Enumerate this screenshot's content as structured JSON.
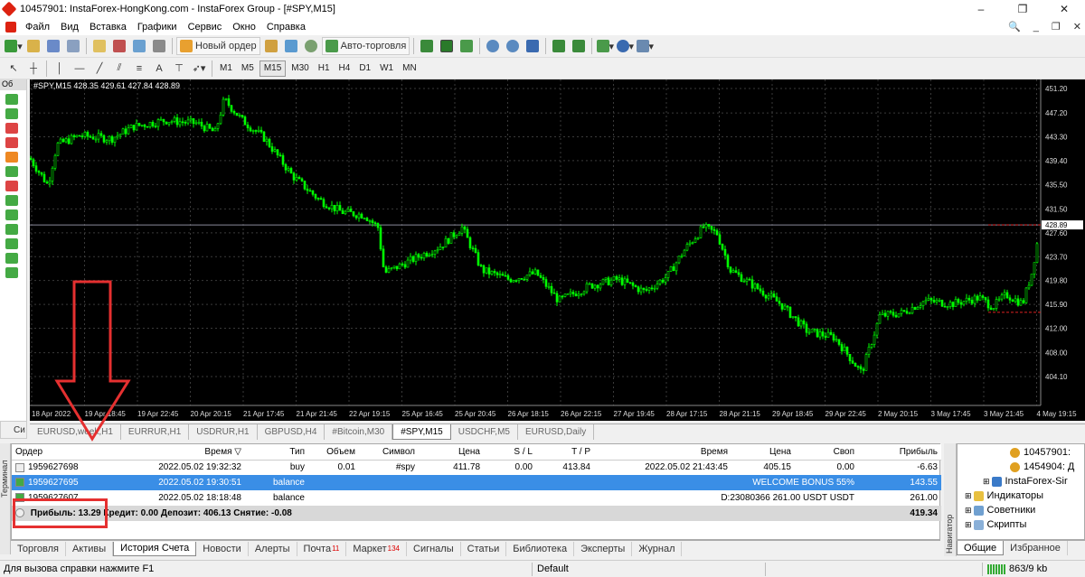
{
  "window": {
    "title": "10457901: InstaForex-HongKong.com - InstaForex Group - [#SPY,M15]",
    "controls": [
      "–",
      "❐",
      "✕"
    ]
  },
  "menu": {
    "items": [
      "Файл",
      "Вид",
      "Вставка",
      "Графики",
      "Сервис",
      "Окно",
      "Справка"
    ],
    "right": [
      "_",
      "❐",
      "✕"
    ]
  },
  "toolbar": {
    "new_order": "Новый ордер",
    "autotrading": "Авто-торговля"
  },
  "timeframes": {
    "items": [
      "M1",
      "M5",
      "M15",
      "M30",
      "H1",
      "H4",
      "D1",
      "W1",
      "MN"
    ],
    "active": "M15"
  },
  "left_panel": {
    "header": "Об"
  },
  "chart": {
    "label": "#SPY,M15  428.35 429.61 427.84 428.89",
    "current_price": "428.89",
    "y_ticks": [
      "451.20",
      "447.20",
      "443.30",
      "439.40",
      "435.50",
      "431.50",
      "427.60",
      "423.70",
      "419.80",
      "415.90",
      "412.00",
      "408.00",
      "404.10"
    ],
    "x_ticks": [
      "18 Apr 2022",
      "19 Apr 18:45",
      "19 Apr 22:45",
      "20 Apr 20:15",
      "21 Apr 17:45",
      "21 Apr 21:45",
      "22 Apr 19:15",
      "25 Apr 16:45",
      "25 Apr 20:45",
      "26 Apr 18:15",
      "26 Apr 22:15",
      "27 Apr 19:45",
      "28 Apr 17:15",
      "28 Apr 21:15",
      "29 Apr 18:45",
      "29 Apr 22:45",
      "2 May 20:15",
      "3 May 17:45",
      "3 May 21:45",
      "4 May 19:15"
    ],
    "colors": {
      "background": "#000000",
      "candles": "#00ff00",
      "grid": "#3a3a3a",
      "price_line": "#8a8a9a"
    }
  },
  "chart_tabs": {
    "items": [
      "EURUSD,week,H1",
      "EURRUR,H1",
      "USDRUR,H1",
      "GBPUSD,H4",
      "#Bitcoin,M30",
      "#SPY,M15",
      "USDCHF,M5",
      "EURUSD,Daily"
    ],
    "active": "#SPY,M15"
  },
  "side_label": "Си",
  "terminal": {
    "strip_label": "Терминал",
    "columns": [
      "Ордер",
      "Время",
      "Тип",
      "Объем",
      "Символ",
      "Цена",
      "S / L",
      "T / P",
      "Время",
      "Цена",
      "Своп",
      "Прибыль"
    ],
    "rows": [
      {
        "order": "1959627698",
        "time": "2022.05.02 19:32:32",
        "type": "buy",
        "volume": "0.01",
        "symbol": "#spy",
        "price": "411.78",
        "sl": "0.00",
        "tp": "413.84",
        "close_time": "2022.05.02 21:43:45",
        "close_price": "405.15",
        "swap": "0.00",
        "profit": "-6.63"
      },
      {
        "order": "1959627695",
        "time": "2022.05.02 19:30:51",
        "type": "balance",
        "comment": "WELCOME BONUS 55%",
        "profit": "143.55"
      },
      {
        "order": "1959627607",
        "time": "2022.05.02 18:18:48",
        "type": "balance",
        "comment": "D:23080366 261.00 USDT USDT",
        "profit": "261.00"
      }
    ],
    "summary": {
      "profit": "Прибыль: 13.29",
      "credit": "Кредит: 0.00",
      "deposit": "Депозит: 406.13",
      "withdrawal": "Снятие: -0.08",
      "total": "419.34"
    },
    "tabs": [
      {
        "label": "Торговля"
      },
      {
        "label": "Активы"
      },
      {
        "label": "История Счета",
        "active": true
      },
      {
        "label": "Новости"
      },
      {
        "label": "Алерты"
      },
      {
        "label": "Почта",
        "badge": "11"
      },
      {
        "label": "Маркет",
        "badge": "134"
      },
      {
        "label": "Сигналы"
      },
      {
        "label": "Статьи"
      },
      {
        "label": "Библиотека"
      },
      {
        "label": "Эксперты"
      },
      {
        "label": "Журнал"
      }
    ]
  },
  "navigator": {
    "strip_label": "Навигатор",
    "items": [
      "10457901:",
      "1454904: Д",
      "InstaForex-Sir",
      "Индикаторы",
      "Советники",
      "Скрипты"
    ],
    "tabs": [
      "Общие",
      "Избранное"
    ]
  },
  "status": {
    "help": "Для вызова справки нажмите F1",
    "profile": "Default",
    "traffic": "863/9 kb"
  }
}
